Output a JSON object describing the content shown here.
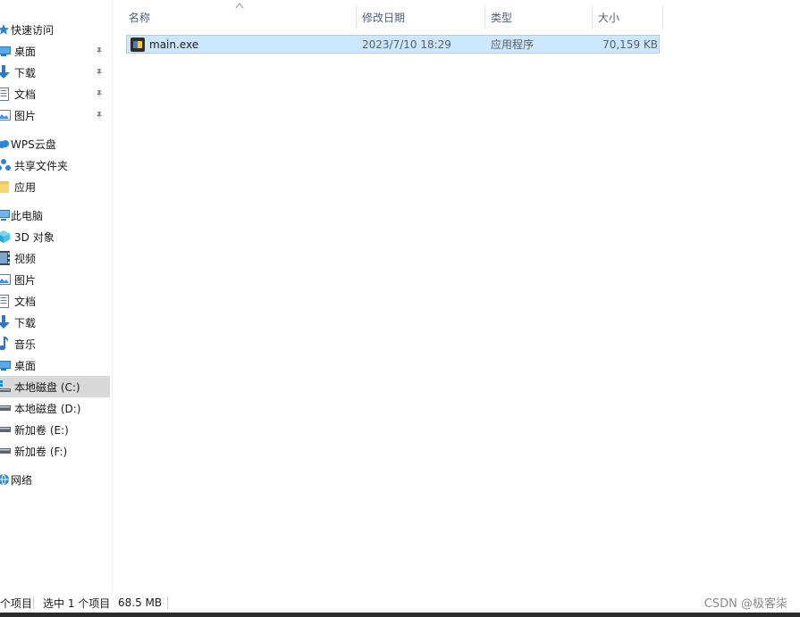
{
  "nav": {
    "quick_access": "快速访问",
    "qa_items": [
      {
        "label": "桌面"
      },
      {
        "label": "下载"
      },
      {
        "label": "文档"
      },
      {
        "label": "图片"
      }
    ],
    "wps_cloud": "WPS云盘",
    "shared_folder": "共享文件夹",
    "apps": "应用",
    "this_pc": "此电脑",
    "pc_items": [
      {
        "label": "3D 对象"
      },
      {
        "label": "视频"
      },
      {
        "label": "图片"
      },
      {
        "label": "文档"
      },
      {
        "label": "下载"
      },
      {
        "label": "音乐"
      },
      {
        "label": "桌面"
      },
      {
        "label": "本地磁盘 (C:)"
      },
      {
        "label": "本地磁盘 (D:)"
      },
      {
        "label": "新加卷 (E:)"
      },
      {
        "label": "新加卷 (F:)"
      }
    ],
    "network": "网络"
  },
  "columns": {
    "name": "名称",
    "modified": "修改日期",
    "type": "类型",
    "size": "大小"
  },
  "files": [
    {
      "name": "main.exe",
      "modified": "2023/7/10 18:29",
      "type": "应用程序",
      "size": "70,159 KB"
    }
  ],
  "status": {
    "count": "个项目",
    "selected": "选中 1 个项目",
    "selected_size": "68.5 MB"
  },
  "watermark": "CSDN @极客柒",
  "colors": {
    "selection_bg": "#cce8ff",
    "selection_border": "#99d1ff",
    "nav_selected": "#d9d9d9",
    "header_text": "#4c607a"
  }
}
